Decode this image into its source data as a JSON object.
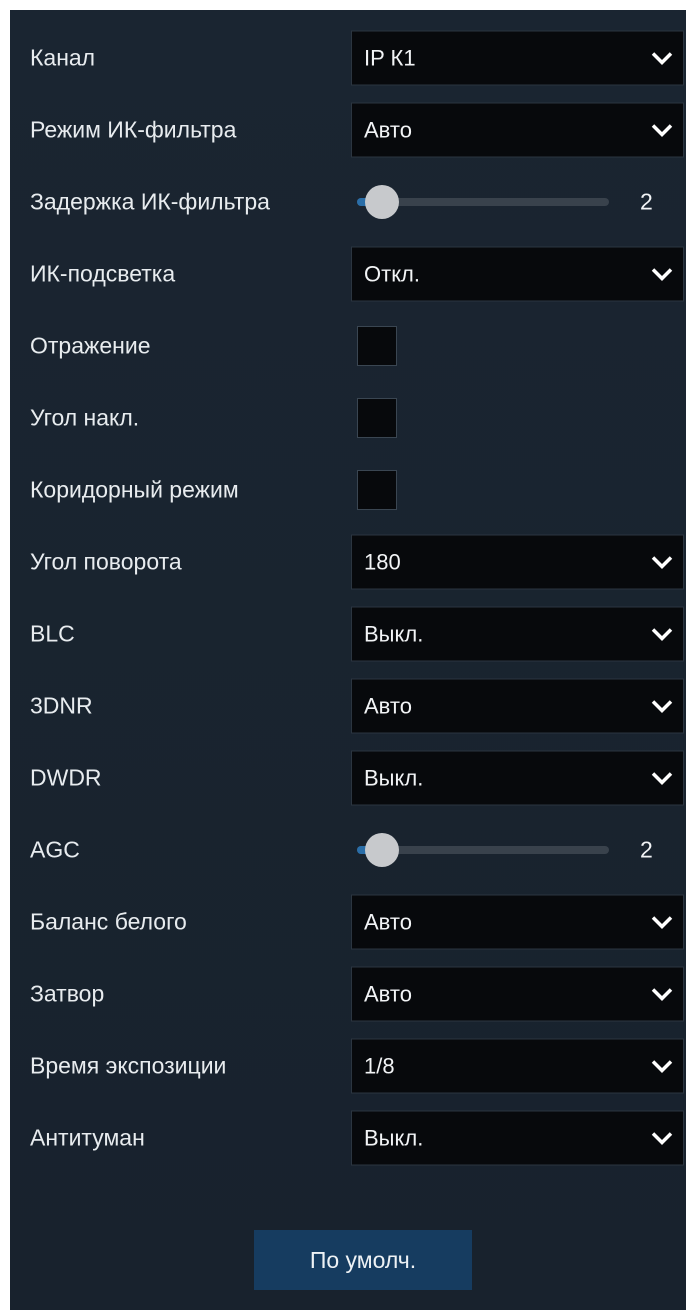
{
  "settings": {
    "channel": {
      "label": "Канал",
      "value": "IP К1"
    },
    "ir_filter_mode": {
      "label": "Режим ИК-фильтра",
      "value": "Авто"
    },
    "ir_filter_delay": {
      "label": "Задержка ИК-фильтра",
      "value": "2",
      "level": 0.1
    },
    "ir_light": {
      "label": "ИК-подсветка",
      "value": "Откл."
    },
    "mirror": {
      "label": "Отражение",
      "checked": false
    },
    "flip": {
      "label": "Угол накл.",
      "checked": false
    },
    "corridor_mode": {
      "label": "Коридорный режим",
      "checked": false
    },
    "rotation": {
      "label": "Угол поворота",
      "value": "180"
    },
    "blc": {
      "label": "BLC",
      "value": "Выкл."
    },
    "dnr": {
      "label": "3DNR",
      "value": "Авто"
    },
    "dwdr": {
      "label": "DWDR",
      "value": "Выкл."
    },
    "agc": {
      "label": "AGC",
      "value": "2",
      "level": 0.1
    },
    "white_balance": {
      "label": "Баланс белого",
      "value": "Авто"
    },
    "shutter": {
      "label": "Затвор",
      "value": "Авто"
    },
    "exposure_time": {
      "label": "Время экспозиции",
      "value": "1/8"
    },
    "defog": {
      "label": "Антитуман",
      "value": "Выкл."
    }
  },
  "footer": {
    "default_label": "По умолч."
  },
  "colors": {
    "panel_bg": "#1a2430",
    "control_bg": "#07090c",
    "accent": "#2a6ea8",
    "button_bg": "#163c60",
    "text": "#e8ecef"
  },
  "icons": {
    "dropdown": "chevron-down-icon",
    "slider_thumb": "slider-thumb"
  }
}
